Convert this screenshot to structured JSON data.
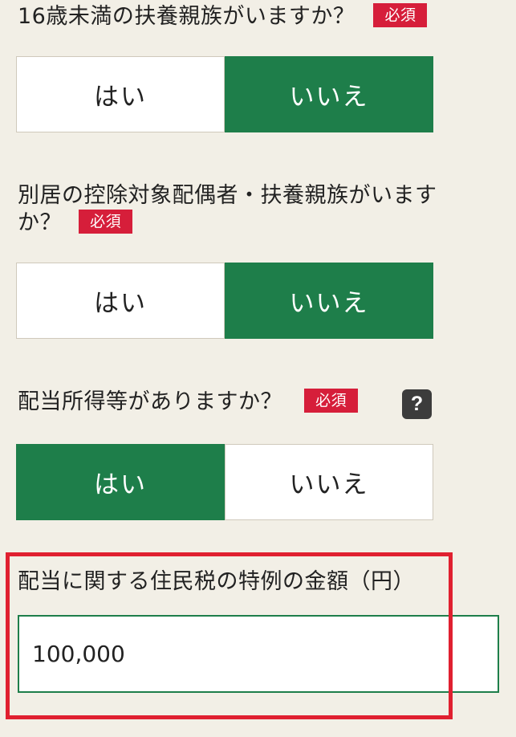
{
  "questions": [
    {
      "label": "16歳未満の扶養親族がいますか？",
      "required": "必須",
      "options": [
        "はい",
        "いいえ"
      ],
      "selected": "いいえ"
    },
    {
      "label_line1": "別居の控除対象配偶者・扶養親族がいます",
      "label_line2": "か？",
      "required": "必須",
      "options": [
        "はい",
        "いいえ"
      ],
      "selected": "いいえ"
    },
    {
      "label": "配当所得等がありますか？",
      "required": "必須",
      "help": "?",
      "options": [
        "はい",
        "いいえ"
      ],
      "selected": "はい"
    }
  ],
  "amount": {
    "label": "配当に関する住民税の特例の金額（円）",
    "value": "100,000"
  },
  "colors": {
    "selected": "#1e7e4a",
    "required_badge": "#d61e3a",
    "highlight_border": "#e02030",
    "background": "#f2efe6"
  },
  "icons": {
    "help": "question-mark-icon"
  }
}
